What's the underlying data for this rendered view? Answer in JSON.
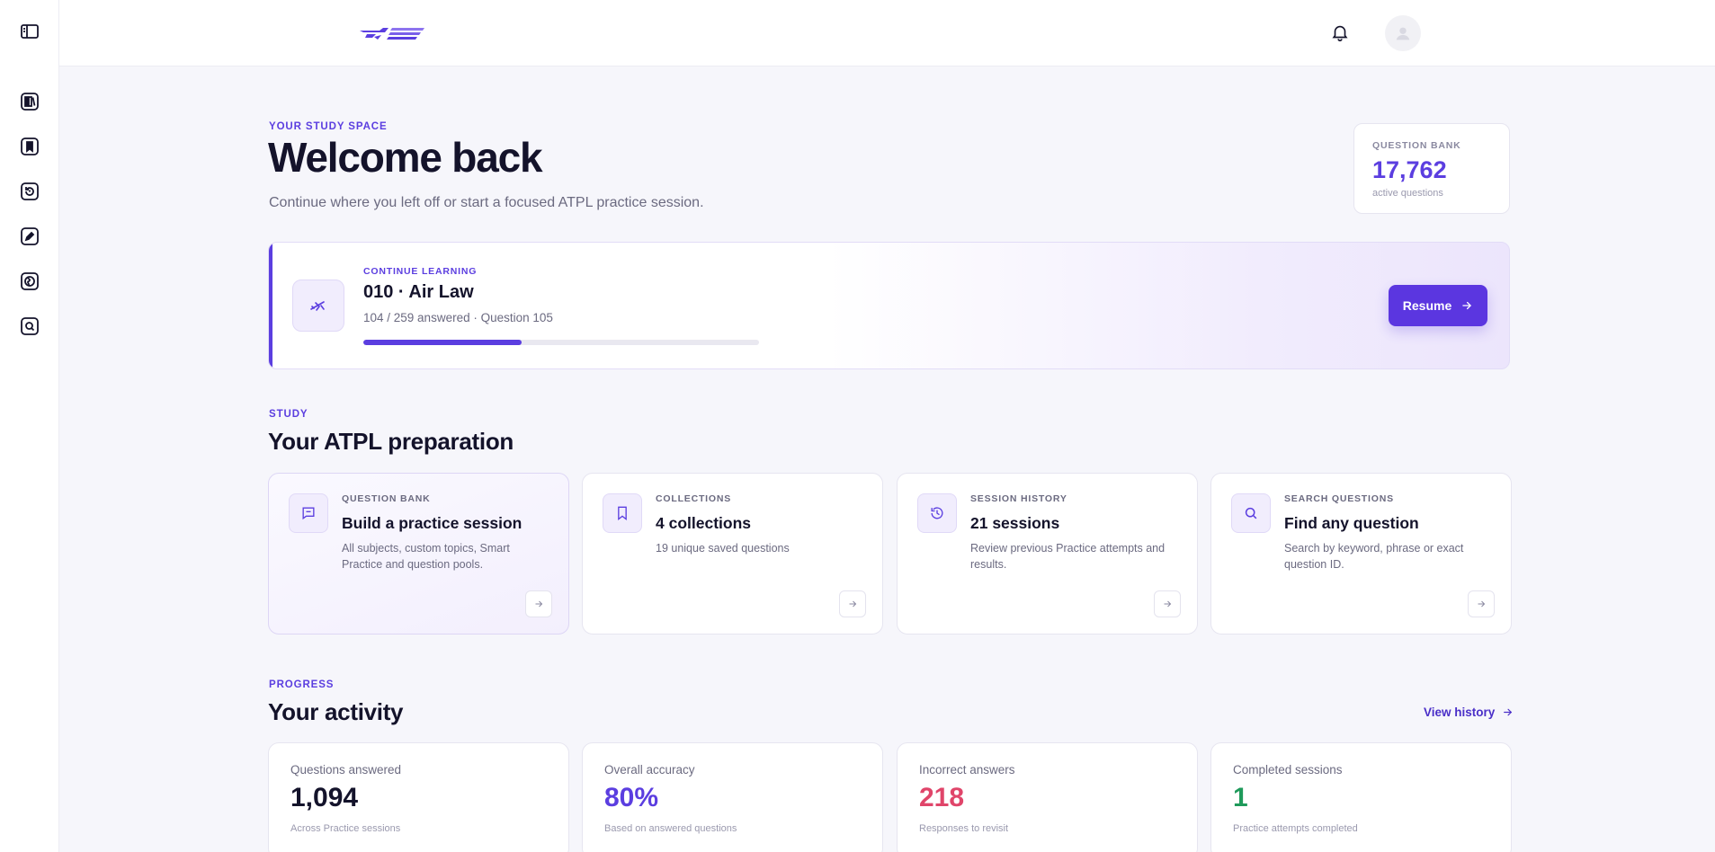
{
  "colors": {
    "accent": "#5b3ee0",
    "incorrect": "#e0456a",
    "completed": "#1f9a5b",
    "text": "#14132b",
    "muted": "#6b6a80"
  },
  "sidebar": {
    "items": [
      {
        "icon": "sidebar-toggle-icon"
      },
      {
        "icon": "question-bank-icon"
      },
      {
        "icon": "bookmark-icon"
      },
      {
        "icon": "history-icon"
      },
      {
        "icon": "edit-icon"
      },
      {
        "icon": "globe-icon"
      },
      {
        "icon": "search-icon"
      }
    ]
  },
  "header": {
    "logo": "logo",
    "bell_icon": "bell-icon",
    "avatar_icon": "user-icon"
  },
  "hero": {
    "eyebrow": "YOUR STUDY SPACE",
    "title": "Welcome back",
    "subtitle": "Continue where you left off or start a focused ATPL practice session."
  },
  "question_bank_summary": {
    "label": "QUESTION BANK",
    "value": "17,762",
    "note": "active questions"
  },
  "continue_learning": {
    "eyebrow": "CONTINUE LEARNING",
    "title": "010 · Air Law",
    "meta": "104 / 259 answered · Question 105",
    "progress_fraction": 0.4,
    "resume_label": "Resume"
  },
  "study": {
    "eyebrow": "STUDY",
    "title": "Your ATPL preparation",
    "cards": [
      {
        "eyebrow": "QUESTION BANK",
        "title": "Build a practice session",
        "desc": "All subjects, custom topics, Smart Practice and question pools.",
        "icon": "message-square-icon"
      },
      {
        "eyebrow": "COLLECTIONS",
        "title": "4 collections",
        "desc": "19 unique saved questions",
        "icon": "bookmark-icon"
      },
      {
        "eyebrow": "SESSION HISTORY",
        "title": "21 sessions",
        "desc": "Review previous Practice attempts and results.",
        "icon": "history-icon"
      },
      {
        "eyebrow": "SEARCH QUESTIONS",
        "title": "Find any question",
        "desc": "Search by keyword, phrase or exact question ID.",
        "icon": "search-icon"
      }
    ]
  },
  "progress": {
    "eyebrow": "PROGRESS",
    "title": "Your activity",
    "view_history": "View history",
    "cards": [
      {
        "label": "Questions answered",
        "value": "1,094",
        "note": "Across Practice sessions"
      },
      {
        "label": "Overall accuracy",
        "value": "80%",
        "note": "Based on answered questions"
      },
      {
        "label": "Incorrect answers",
        "value": "218",
        "note": "Responses to revisit"
      },
      {
        "label": "Completed sessions",
        "value": "1",
        "note": "Practice attempts completed"
      }
    ]
  }
}
